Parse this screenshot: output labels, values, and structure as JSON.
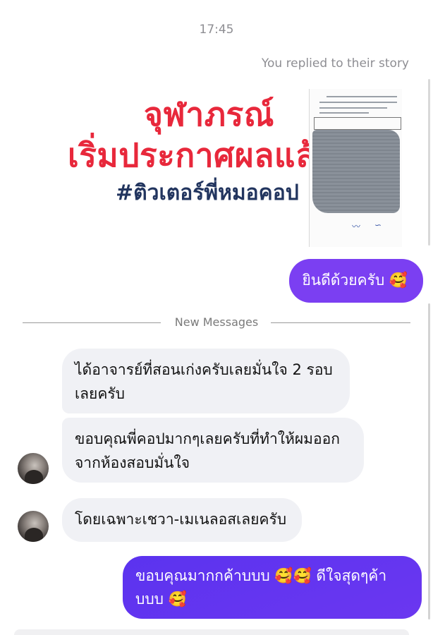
{
  "header": {
    "timestamp": "17:45",
    "reply_note": "You replied to their story"
  },
  "story": {
    "line1": "จุฬาภรณ์",
    "line2": "เริ่มประกาศผลแล้ว",
    "line3": "#ติวเตอร์พี่หมอคอป",
    "colors": {
      "headline": "#e8283b",
      "hashtag": "#22355f"
    }
  },
  "messages": {
    "reply": "ยินดีด้วยครับ 🥰",
    "divider_label": "New Messages",
    "incoming": [
      {
        "text": "ได้อาจารย์ที่สอนเก่งครับเลยมั่นใจ 2 รอบเลยครับ"
      },
      {
        "text": "ขอบคุณพี่คอปมากๆเลยครับที่ทำให้ผมออกจากห้องสอบมั่นใจ"
      },
      {
        "text": "โดยเฉพาะเชวา-เมเนลอสเลยครับ"
      }
    ],
    "outgoing_last": "ขอบคุณมากกค้าบบบ 🥰🥰 ดีใจสุดๆค้าบบบ 🥰"
  },
  "colors": {
    "outgoing_bubble": "#7b3ff2",
    "incoming_bubble": "#f0f1f5",
    "meta_text": "#8e8e93"
  }
}
